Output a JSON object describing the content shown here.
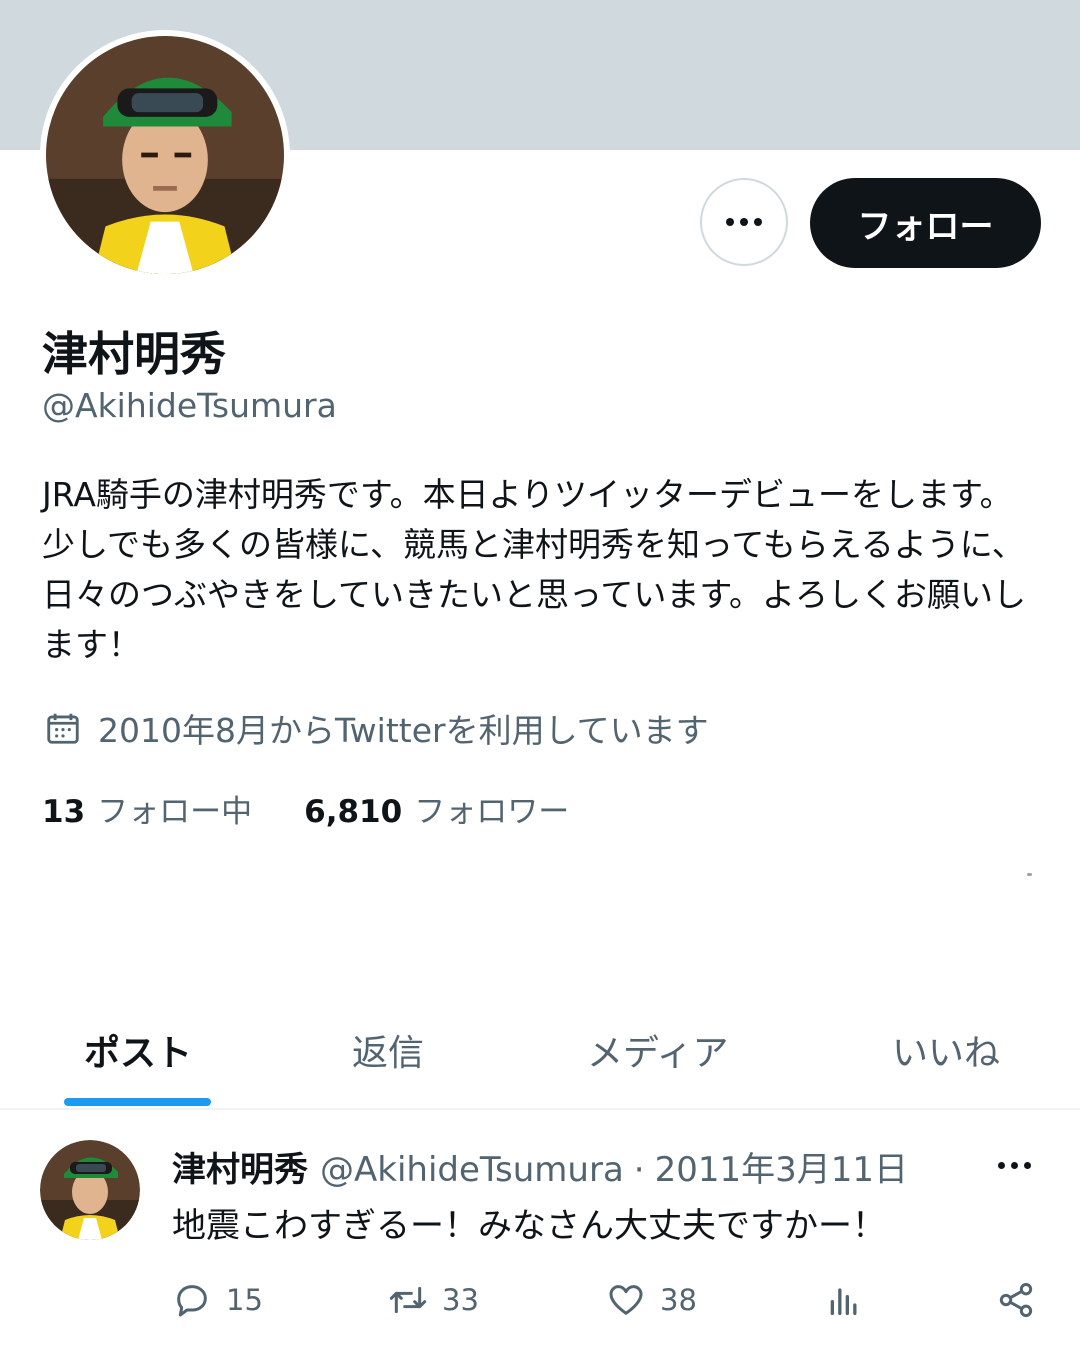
{
  "profile": {
    "name": "津村明秀",
    "handle": "@AkihideTsumura",
    "bio": "JRA騎手の津村明秀です。本日よりツイッターデビューをします。少しでも多くの皆様に、競馬と津村明秀を知ってもらえるように、日々のつぶやきをしていきたいと思っています。よろしくお願いします！",
    "joined": "2010年8月からTwitterを利用しています",
    "following_count": "13",
    "following_label": "フォロー中",
    "followers_count": "6,810",
    "followers_label": "フォロワー",
    "follow_button": "フォロー"
  },
  "tabs": [
    {
      "label": "ポスト",
      "active": true
    },
    {
      "label": "返信",
      "active": false
    },
    {
      "label": "メディア",
      "active": false
    },
    {
      "label": "いいね",
      "active": false
    }
  ],
  "post": {
    "name": "津村明秀",
    "handle": "@AkihideTsumura",
    "separator": "·",
    "date": "2011年3月11日",
    "text": "地震こわすぎるー！みなさん大丈夫ですかー！",
    "replies": "15",
    "reposts": "33",
    "likes": "38"
  },
  "colors": {
    "banner": "#cfd9de",
    "accent": "#1d9bf0",
    "primary_text": "#0f1419",
    "secondary_text": "#536471",
    "follow_button_bg": "#0f1419"
  },
  "icons": [
    "more-dots-icon",
    "calendar-icon",
    "reply-icon",
    "repost-icon",
    "like-icon",
    "views-icon",
    "share-icon"
  ]
}
